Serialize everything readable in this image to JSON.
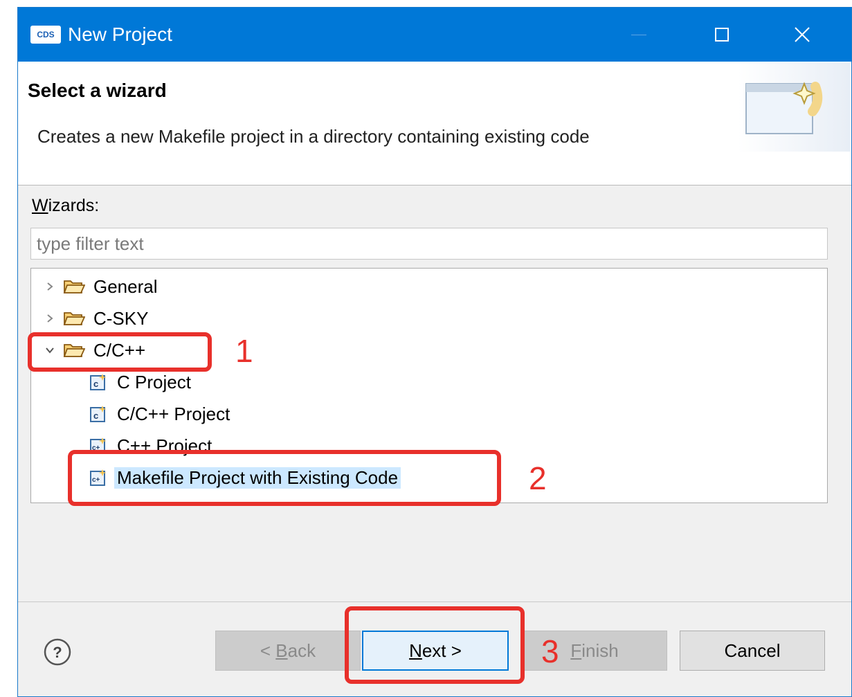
{
  "window": {
    "title": "New Project",
    "app_icon_text": "CDS"
  },
  "header": {
    "title": "Select a wizard",
    "description": "Creates a new Makefile project in a directory containing existing code"
  },
  "wizards": {
    "label_mnemonic": "W",
    "label_rest": "izards:",
    "filter_placeholder": "type filter text"
  },
  "tree": [
    {
      "label": "General",
      "type": "folder",
      "expanded": false,
      "level": 0
    },
    {
      "label": "C-SKY",
      "type": "folder",
      "expanded": false,
      "level": 0
    },
    {
      "label": "C/C++",
      "type": "folder",
      "expanded": true,
      "level": 0
    },
    {
      "label": "C Project",
      "type": "c-project",
      "level": 1
    },
    {
      "label": "C/C++ Project",
      "type": "c-project",
      "level": 1
    },
    {
      "label": "C++ Project",
      "type": "cpp-project",
      "level": 1
    },
    {
      "label": "Makefile Project with Existing Code",
      "type": "cpp-project",
      "level": 1,
      "selected": true
    }
  ],
  "buttons": {
    "back_prefix": "< ",
    "back_mnemonic": "B",
    "back_rest": "ack",
    "next_mnemonic": "N",
    "next_rest": "ext >",
    "finish_mnemonic": "F",
    "finish_rest": "inish",
    "cancel": "Cancel"
  },
  "annotations": {
    "step1": "1",
    "step2": "2",
    "step3": "3"
  },
  "colors": {
    "titlebar": "#0078d7",
    "selection": "#cce8ff",
    "annotation": "#e8302b",
    "default_button_border": "#0078d7"
  }
}
